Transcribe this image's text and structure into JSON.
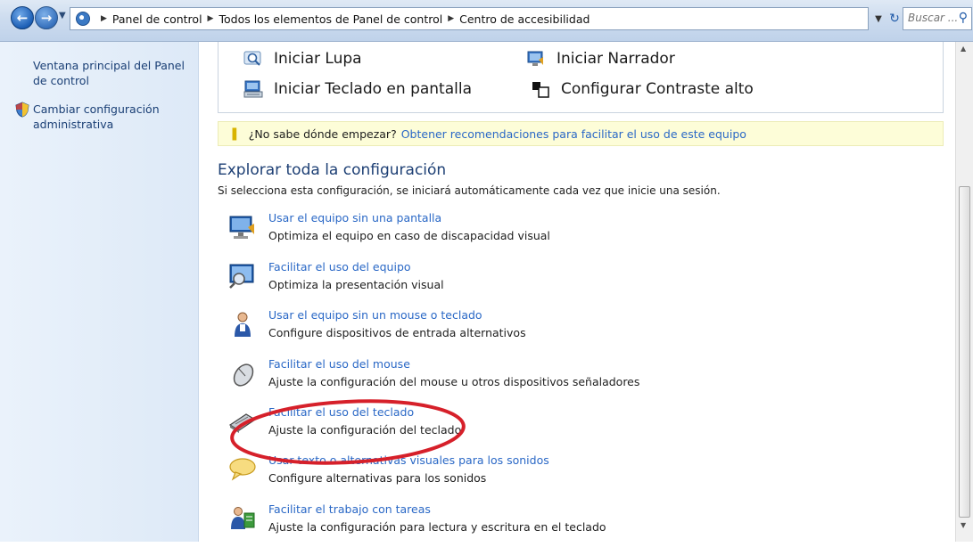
{
  "address_bar": {
    "breadcrumbs": [
      "Panel de control",
      "Todos los elementos de Panel de control",
      "Centro de accesibilidad"
    ],
    "search_placeholder": "Buscar ..."
  },
  "sidebar": {
    "items": [
      {
        "label": "Ventana principal del Panel de control",
        "icon": null
      },
      {
        "label": "Cambiar configuración administrativa",
        "icon": "shield-icon"
      }
    ]
  },
  "quick_access": {
    "items": [
      {
        "label": "Iniciar Lupa",
        "icon": "magnifier-icon"
      },
      {
        "label": "Iniciar Narrador",
        "icon": "narrator-icon"
      },
      {
        "label": "Iniciar Teclado en pantalla",
        "icon": "onscreen-keyboard-icon"
      },
      {
        "label": "Configurar Contraste alto",
        "icon": "high-contrast-icon"
      }
    ]
  },
  "tip": {
    "question": "¿No sabe dónde empezar?",
    "link": "Obtener recomendaciones para facilitar el uso de este equipo"
  },
  "explore": {
    "heading": "Explorar toda la configuración",
    "description": "Si selecciona esta configuración, se iniciará automáticamente cada vez que inicie una sesión.",
    "items": [
      {
        "link": "Usar el equipo sin una pantalla",
        "desc": "Optimiza el equipo en caso de discapacidad visual",
        "icon": "monitor-icon"
      },
      {
        "link": "Facilitar el uso del equipo",
        "desc": "Optimiza la presentación visual",
        "icon": "display-magnify-icon"
      },
      {
        "link": "Usar el equipo sin un mouse o teclado",
        "desc": "Configure dispositivos de entrada alternativos",
        "icon": "person-icon"
      },
      {
        "link": "Facilitar el uso del mouse",
        "desc": "Ajuste la configuración del mouse u otros dispositivos señaladores",
        "icon": "mouse-icon"
      },
      {
        "link": "Facilitar el uso del teclado",
        "desc": "Ajuste la configuración del teclado",
        "icon": "keyboard-icon"
      },
      {
        "link": "Usar texto o alternativas visuales para los sonidos",
        "desc": "Configure alternativas para los sonidos",
        "icon": "speech-bubble-icon"
      },
      {
        "link": "Facilitar el trabajo con tareas",
        "desc": "Ajuste la configuración para lectura y escritura en el teclado",
        "icon": "people-icon"
      }
    ]
  },
  "annotation": {
    "color": "#d6202a",
    "highlighted_item": "Facilitar el uso del teclado"
  }
}
